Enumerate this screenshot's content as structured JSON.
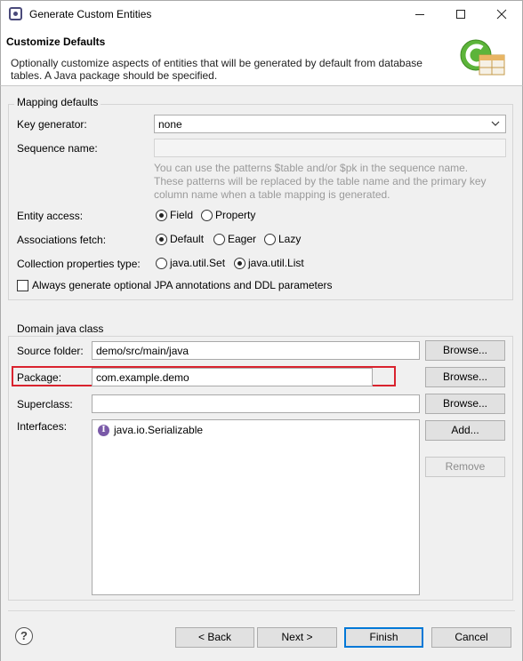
{
  "window": {
    "title": "Generate Custom Entities",
    "min_icon": "minimize-icon",
    "max_icon": "maximize-icon",
    "close_icon": "close-icon"
  },
  "header": {
    "title": "Customize Defaults",
    "description": "Optionally customize aspects of entities that will be generated by default from database tables. A Java package should be specified."
  },
  "mapping": {
    "group_label": "Mapping defaults",
    "key_generator_label": "Key generator:",
    "key_generator_value": "none",
    "sequence_label": "Sequence name:",
    "sequence_value": "",
    "hint_line1": "You can use the patterns $table and/or $pk in the sequence name.",
    "hint_line2": "These patterns will be replaced by the table name and the primary key",
    "hint_line3": "column name when a table mapping is generated.",
    "entity_access_label": "Entity access:",
    "entity_access_options": [
      "Field",
      "Property"
    ],
    "entity_access_selected": "Field",
    "assoc_fetch_label": "Associations fetch:",
    "assoc_fetch_options": [
      "Default",
      "Eager",
      "Lazy"
    ],
    "assoc_fetch_selected": "Default",
    "collection_label": "Collection properties type:",
    "collection_options": [
      "java.util.Set",
      "java.util.List"
    ],
    "collection_selected": "java.util.List",
    "optional_jpa_label": "Always generate optional JPA annotations and DDL parameters",
    "optional_jpa_checked": false
  },
  "domain": {
    "group_label": "Domain java class",
    "source_folder_label": "Source folder:",
    "source_folder_value": "demo/src/main/java",
    "package_label": "Package:",
    "package_value": "com.example.demo",
    "superclass_label": "Superclass:",
    "superclass_value": "",
    "interfaces_label": "Interfaces:",
    "interfaces": [
      "java.io.Serializable"
    ],
    "browse_label": "Browse...",
    "add_label": "Add...",
    "remove_label": "Remove"
  },
  "footer": {
    "help_icon": "help-icon",
    "back_label": "< Back",
    "next_label": "Next >",
    "finish_label": "Finish",
    "cancel_label": "Cancel"
  },
  "colors": {
    "highlight": "#d9232e",
    "primary_border": "#0078d7",
    "hint_text": "#9a9a9a"
  }
}
